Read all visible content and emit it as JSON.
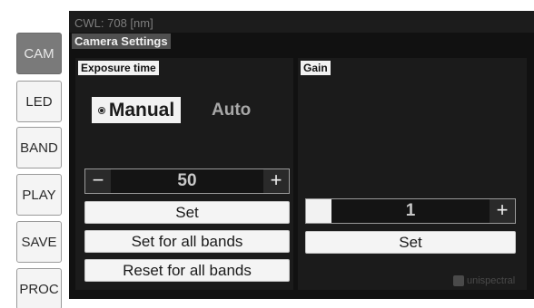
{
  "sidebar": {
    "items": [
      {
        "label": "CAM",
        "active": true
      },
      {
        "label": "LED",
        "active": false
      },
      {
        "label": "BAND",
        "active": false
      },
      {
        "label": "PLAY",
        "active": false
      },
      {
        "label": "SAVE",
        "active": false
      },
      {
        "label": "PROC",
        "active": false
      }
    ]
  },
  "header": {
    "cwl": "CWL: 708 [nm]",
    "title": "Camera Settings"
  },
  "exposure": {
    "title": "Exposure time",
    "mode_manual": "Manual",
    "mode_auto": "Auto",
    "selected_mode": "Manual",
    "minus": "−",
    "plus": "+",
    "value": "50",
    "set": "Set",
    "set_all": "Set for all bands",
    "reset_all": "Reset for all bands"
  },
  "gain": {
    "title": "Gain",
    "minus": "",
    "plus": "+",
    "value": "1",
    "set": "Set"
  },
  "logo": {
    "text": "unispectral"
  },
  "colors": {
    "background": "#111111",
    "panel": "#1b1b1b",
    "active_nav": "#7a7a7a"
  },
  "icons": {
    "radio": "radio-selected-icon",
    "logo": "unispectral-logo-icon"
  }
}
